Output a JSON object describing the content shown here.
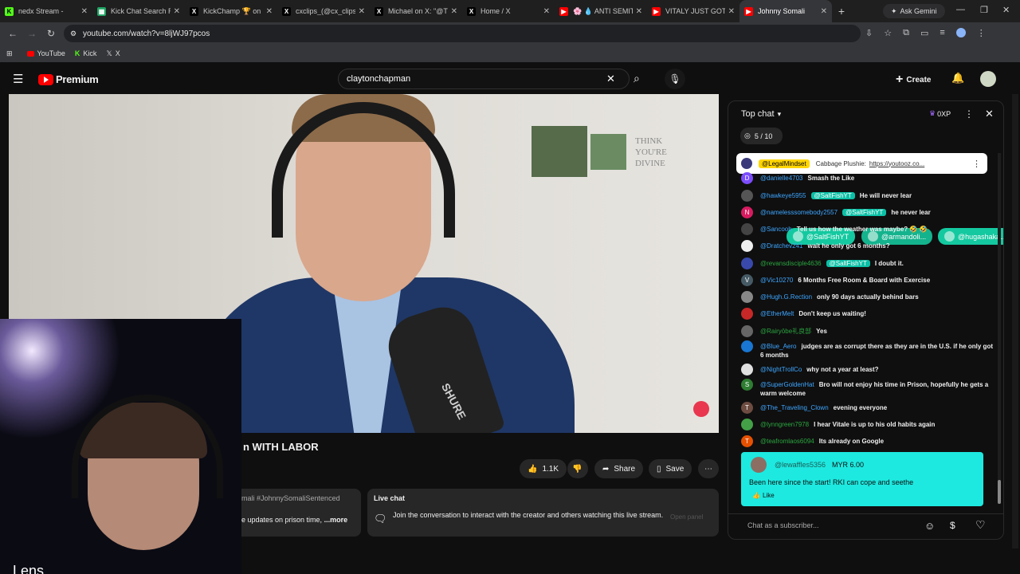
{
  "tabs": [
    {
      "title": "nedx Stream -",
      "color": "#53fc18",
      "glyph": "K"
    },
    {
      "title": "Kick Chat Search R",
      "color": "#1ea362",
      "glyph": "▦"
    },
    {
      "title": "KickChamp 🏆 on X",
      "color": "#000000",
      "glyph": "X"
    },
    {
      "title": "cxclips_(@cx_clips",
      "color": "#000000",
      "glyph": "X"
    },
    {
      "title": "Michael on X: \"@T",
      "color": "#000000",
      "glyph": "X"
    },
    {
      "title": "Home / X",
      "color": "#000000",
      "glyph": "X"
    },
    {
      "title": "🌸 💧 ANTI SEMIT",
      "color": "#ff0000",
      "glyph": "▶"
    },
    {
      "title": "VITALY JUST GOT S",
      "color": "#ff0000",
      "glyph": "▶"
    },
    {
      "title": "Johnny Somali",
      "color": "#ff0000",
      "glyph": "▶"
    }
  ],
  "browser": {
    "ask_gemini": "Ask Gemini",
    "url": "youtube.com/watch?v=8ljWJ97pcos",
    "bookmarks": [
      "YouTube",
      "Kick",
      "X"
    ]
  },
  "yt": {
    "brand": "Premium",
    "search_value": "claytonchapman",
    "create": "Create"
  },
  "video": {
    "poster_lines": [
      "THINK",
      "YOU'RE",
      "DIVINE"
    ],
    "mic_text": "SHURE"
  },
  "below": {
    "title_fragment": "n WITH LABOR",
    "likes": "1.1K",
    "share": "Share",
    "save": "Save",
    "desc_line1": "mali #JohnnySomaliSentenced",
    "desc_line2": "e updates on prison time,",
    "more": "...more",
    "cam_text": "Lens"
  },
  "live_chat_card": {
    "heading": "Live chat",
    "body": "Join the conversation to interact with the creator and others watching this live stream.",
    "open": "Open panel"
  },
  "chat": {
    "header": "Top chat",
    "xp": "0XP",
    "progress": "5 / 10",
    "pills": [
      {
        "name": "@SaltFishYT",
        "color": "#14c9a0"
      },
      {
        "name": "@armandoli...",
        "color": "#14b38d"
      },
      {
        "name": "@hugashaka...",
        "color": "#14c9a0"
      }
    ],
    "pinned": {
      "author": "@LegalMindset",
      "text": "Cabbage Plushie:",
      "link": "https://youtooz.co..."
    },
    "messages": [
      {
        "av": "D",
        "avc": "#7c4dff",
        "author": "@danielle4703",
        "text": "Smash the Like",
        "badge": ""
      },
      {
        "av": "",
        "avc": "#555",
        "author": "@hawkeye5955",
        "badge": "@SaltFishYT",
        "text": "He will never lear"
      },
      {
        "av": "N",
        "avc": "#d81b60",
        "author": "@namelesssomebody2557",
        "badge": "@SaltFishYT",
        "text": "he never lear"
      },
      {
        "av": "",
        "avc": "#444",
        "author": "@Sancooh",
        "text": "Tell us how the weather was maybe? 🤣 🤣",
        "badge": ""
      },
      {
        "av": "",
        "avc": "#eee",
        "author": "@Dratchev241",
        "text": "wait he only got 6 months?",
        "badge": ""
      },
      {
        "av": "",
        "avc": "#3949ab",
        "author": "@revansdisciple4636",
        "badge": "@SaltFishYT",
        "text": "I doubt it.",
        "g": true
      },
      {
        "av": "V",
        "avc": "#455a64",
        "author": "@Vic10270",
        "text": "6 Months Free Room & Board with Exercise",
        "badge": ""
      },
      {
        "av": "",
        "avc": "#888",
        "author": "@Hugh.G.Rection",
        "text": "only 90 days actually behind bars",
        "badge": ""
      },
      {
        "av": "",
        "avc": "#c62828",
        "author": "@EtherMelt",
        "text": "Don't keep us waiting!",
        "badge": ""
      },
      {
        "av": "",
        "avc": "#666",
        "author": "@Rairyōbe礼良部",
        "text": "Yes",
        "badge": "",
        "g": true
      },
      {
        "av": "",
        "avc": "#1976d2",
        "author": "@Blue_Aero",
        "text": "judges are as corrupt there as they are in the U.S. if he only got 6 months",
        "badge": ""
      },
      {
        "av": "",
        "avc": "#e0e0e0",
        "author": "@NightTrollCo",
        "text": "why not a year at least?",
        "badge": ""
      },
      {
        "av": "S",
        "avc": "#2e7d32",
        "author": "@SuperGoldenHat",
        "text": "Bro will not enjoy his time in Prison, hopefully he gets a warm welcome",
        "badge": ""
      },
      {
        "av": "T",
        "avc": "#6d4c41",
        "author": "@The_Traveling_Clown",
        "text": "evening everyone",
        "badge": ""
      },
      {
        "av": "",
        "avc": "#43a047",
        "author": "@lynngreen7978",
        "text": "I hear Vitale is up to his old habits again",
        "badge": "",
        "g": true
      },
      {
        "av": "T",
        "avc": "#e65100",
        "author": "@teafromlaos6094",
        "text": "Its already on Google",
        "badge": "",
        "g": true
      }
    ],
    "superchat": {
      "author": "@lewaffles5356",
      "amount": "MYR 6.00",
      "text": "Been here since the start! RKI can cope and seethe",
      "like": "Like"
    },
    "input_placeholder": "Chat as a subscriber..."
  }
}
